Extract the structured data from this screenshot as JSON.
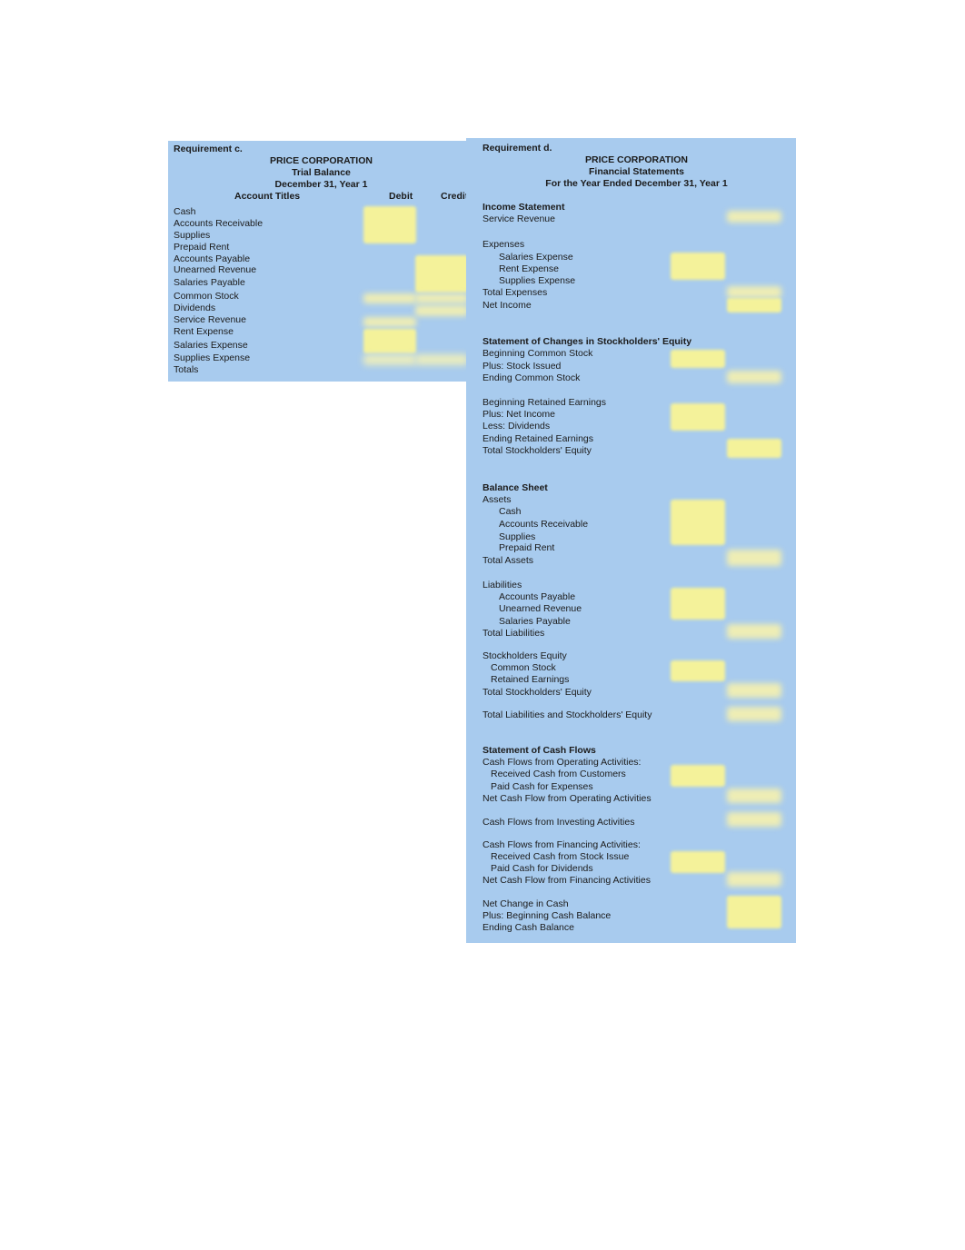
{
  "document": {
    "kind": "accounting-worksheet",
    "background_color": "#ffffff",
    "panel_color": "#a8cbee",
    "input_cell_color": "#f4f29a"
  },
  "trial_balance_panel": {
    "requirement_label": "Requirement c.",
    "company": "PRICE CORPORATION",
    "statement_title": "Trial Balance",
    "period": "December 31, Year 1",
    "columns": [
      "Account Titles",
      "Debit",
      "Credit"
    ],
    "rows": [
      {
        "account": "Cash",
        "debit_cell": true,
        "credit_cell": false
      },
      {
        "account": "Accounts Receivable",
        "debit_cell": true,
        "credit_cell": false
      },
      {
        "account": "Supplies",
        "debit_cell": true,
        "credit_cell": false
      },
      {
        "account": "Prepaid Rent",
        "debit_cell": true,
        "credit_cell": false
      },
      {
        "account": "Accounts Payable",
        "debit_cell": false,
        "credit_cell": true
      },
      {
        "account": "Unearned Revenue",
        "debit_cell": false,
        "credit_cell": true
      },
      {
        "account": "Salaries Payable",
        "debit_cell": false,
        "credit_cell": true
      },
      {
        "account": "Common Stock",
        "debit_cell": false,
        "credit_cell": true
      },
      {
        "account": "Dividends",
        "debit_cell": true,
        "credit_cell": false
      },
      {
        "account": "Service Revenue",
        "debit_cell": false,
        "credit_cell": true
      },
      {
        "account": "Rent Expense",
        "debit_cell": true,
        "credit_cell": false
      },
      {
        "account": "Salaries Expense",
        "debit_cell": true,
        "credit_cell": false
      },
      {
        "account": "Supplies Expense",
        "debit_cell": true,
        "credit_cell": false
      },
      {
        "account": "Totals",
        "debit_cell": true,
        "credit_cell": true
      }
    ]
  },
  "financial_statements_panel": {
    "requirement_label": "Requirement d.",
    "company": "PRICE CORPORATION",
    "statement_title": "Financial Statements",
    "period": "For the Year Ended December 31, Year 1",
    "income_statement": {
      "heading": "Income Statement",
      "lines": [
        {
          "label": "Service Revenue",
          "indent": 0,
          "cell": "outer"
        },
        {
          "label": "Expenses",
          "indent": 0,
          "cell": "none"
        },
        {
          "label": "Salaries Expense",
          "indent": 2,
          "cell": "inner"
        },
        {
          "label": "Rent Expense",
          "indent": 2,
          "cell": "inner"
        },
        {
          "label": "Supplies Expense",
          "indent": 2,
          "cell": "inner"
        },
        {
          "label": "Total Expenses",
          "indent": 0,
          "cell": "outer"
        },
        {
          "label": "Net Income",
          "indent": 0,
          "cell": "outer"
        }
      ]
    },
    "changes_in_equity": {
      "heading": "Statement of Changes in Stockholders' Equity",
      "lines": [
        {
          "label": "Beginning Common Stock",
          "indent": 0,
          "cell": "inner"
        },
        {
          "label": "Plus: Stock Issued",
          "indent": 0,
          "cell": "inner"
        },
        {
          "label": "Ending Common Stock",
          "indent": 0,
          "cell": "outer"
        },
        {
          "label": "Beginning Retained Earnings",
          "indent": 0,
          "cell": "inner"
        },
        {
          "label": "Plus: Net Income",
          "indent": 0,
          "cell": "inner"
        },
        {
          "label": "Less: Dividends",
          "indent": 0,
          "cell": "inner"
        },
        {
          "label": "Ending Retained Earnings",
          "indent": 0,
          "cell": "outer"
        },
        {
          "label": "Total Stockholders' Equity",
          "indent": 0,
          "cell": "outer"
        }
      ]
    },
    "balance_sheet": {
      "heading": "Balance Sheet",
      "lines": [
        {
          "label": "Assets",
          "indent": 0,
          "cell": "none"
        },
        {
          "label": "Cash",
          "indent": 2,
          "cell": "inner"
        },
        {
          "label": "Accounts Receivable",
          "indent": 2,
          "cell": "inner"
        },
        {
          "label": "Supplies",
          "indent": 2,
          "cell": "inner"
        },
        {
          "label": "Prepaid Rent",
          "indent": 2,
          "cell": "inner"
        },
        {
          "label": "Total Assets",
          "indent": 0,
          "cell": "outer"
        },
        {
          "label": "Liabilities",
          "indent": 0,
          "cell": "none"
        },
        {
          "label": "Accounts Payable",
          "indent": 2,
          "cell": "inner"
        },
        {
          "label": "Unearned Revenue",
          "indent": 2,
          "cell": "inner"
        },
        {
          "label": "Salaries Payable",
          "indent": 2,
          "cell": "inner"
        },
        {
          "label": "Total Liabilities",
          "indent": 0,
          "cell": "outer"
        },
        {
          "label": "Stockholders Equity",
          "indent": 0,
          "cell": "none"
        },
        {
          "label": "Common Stock",
          "indent": 1,
          "cell": "inner"
        },
        {
          "label": "Retained Earnings",
          "indent": 1,
          "cell": "inner"
        },
        {
          "label": "Total Stockholders' Equity",
          "indent": 0,
          "cell": "outer"
        },
        {
          "label": "Total Liabilities and Stockholders' Equity",
          "indent": 0,
          "cell": "outer"
        }
      ]
    },
    "cash_flows": {
      "heading": "Statement of Cash Flows",
      "lines": [
        {
          "label": "Cash Flows from Operating Activities:",
          "indent": 0,
          "cell": "none"
        },
        {
          "label": "Received Cash from Customers",
          "indent": 1,
          "cell": "inner"
        },
        {
          "label": "Paid Cash for Expenses",
          "indent": 1,
          "cell": "inner"
        },
        {
          "label": "Net Cash Flow from Operating Activities",
          "indent": 0,
          "cell": "outer"
        },
        {
          "label": "Cash Flows from Investing Activities",
          "indent": 0,
          "cell": "outer"
        },
        {
          "label": "Cash Flows from Financing Activities:",
          "indent": 0,
          "cell": "none"
        },
        {
          "label": "Received Cash from Stock Issue",
          "indent": 1,
          "cell": "inner"
        },
        {
          "label": "Paid Cash for Dividends",
          "indent": 1,
          "cell": "inner"
        },
        {
          "label": "Net Cash Flow from Financing Activities",
          "indent": 0,
          "cell": "outer"
        },
        {
          "label": "Net Change in Cash",
          "indent": 0,
          "cell": "outer"
        },
        {
          "label": "Plus: Beginning Cash Balance",
          "indent": 0,
          "cell": "outer"
        },
        {
          "label": "Ending Cash Balance",
          "indent": 0,
          "cell": "outer"
        }
      ]
    }
  }
}
